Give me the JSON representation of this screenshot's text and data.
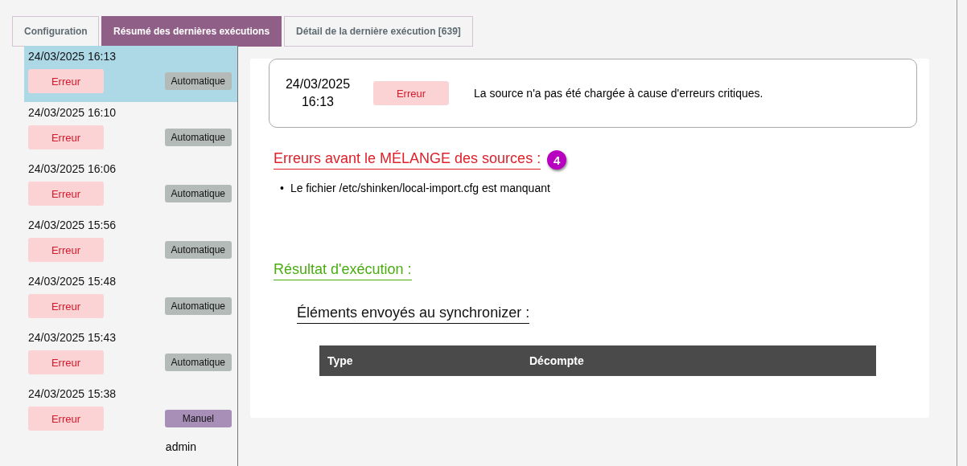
{
  "tabs": [
    {
      "label": "Configuration",
      "selected": false
    },
    {
      "label": "Résumé des dernières exécutions",
      "selected": true
    },
    {
      "label": "Détail de la dernière exécution [639]",
      "selected": false
    }
  ],
  "runs": [
    {
      "date": "24/03/2025 16:13",
      "status_label": "Erreur",
      "kind": "auto",
      "mode_label": "Automatique",
      "selected": true
    },
    {
      "date": "24/03/2025 16:10",
      "status_label": "Erreur",
      "kind": "auto",
      "mode_label": "Automatique",
      "selected": false
    },
    {
      "date": "24/03/2025 16:06",
      "status_label": "Erreur",
      "kind": "auto",
      "mode_label": "Automatique",
      "selected": false
    },
    {
      "date": "24/03/2025 15:56",
      "status_label": "Erreur",
      "kind": "auto",
      "mode_label": "Automatique",
      "selected": false
    },
    {
      "date": "24/03/2025 15:48",
      "status_label": "Erreur",
      "kind": "auto",
      "mode_label": "Automatique",
      "selected": false
    },
    {
      "date": "24/03/2025 15:43",
      "status_label": "Erreur",
      "kind": "auto",
      "mode_label": "Automatique",
      "selected": false
    },
    {
      "date": "24/03/2025 15:38",
      "status_label": "Erreur",
      "kind": "manual",
      "mode_label": "Manuel",
      "user": "admin",
      "selected": false
    }
  ],
  "summary": {
    "date": "24/03/2025",
    "time": "16:13",
    "status_label": "Erreur",
    "message": "La source n'a pas été chargée à cause d'erreurs critiques."
  },
  "errors_section": {
    "title": "Erreurs avant le MÉLANGE des sources :",
    "count": "4",
    "items": [
      {
        "bullet": "•",
        "text": "Le fichier /etc/shinken/local-import.cfg est manquant"
      }
    ]
  },
  "result_section": {
    "title": "Résultat d'exécution :",
    "subtitle": "Éléments envoyés au synchronizer :",
    "table": {
      "columns": [
        "Type",
        "Décompte"
      ]
    }
  }
}
